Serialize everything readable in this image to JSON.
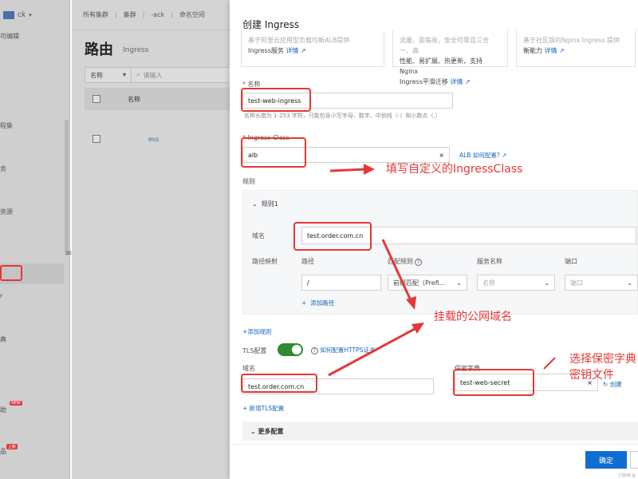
{
  "sidebar": {
    "cluster": "ck",
    "items": [
      "可编辑",
      "程集",
      "务",
      "资源",
      "r",
      "典",
      "助",
      "品"
    ],
    "badge_new": "NEW",
    "badge_hot": "上新"
  },
  "main": {
    "breadcrumb": [
      "所有集群",
      "集群",
      "-ack",
      "命名空间"
    ],
    "title": "路由",
    "subtitle": "Ingress",
    "filter_select": "名称",
    "filter_placeholder": "请输入",
    "col_name": "名称",
    "row_name": "ess"
  },
  "drawer": {
    "title": "创建 Ingress",
    "cards": [
      {
        "line1": "基于阿里云应用型负载均衡ALB提供",
        "line2": "Ingress服务",
        "link": "详情"
      },
      {
        "line1": "流量，面临易，安全可靠且三合一，高",
        "line2": "性能、易扩展、热更新，支持Nginx",
        "line3": "Ingress平滑迁移",
        "link": "详情"
      },
      {
        "line1": "基于社区版的Nginx Ingress 提供",
        "line2": "衡能力",
        "link": "详情"
      }
    ],
    "name_label": "名称",
    "name_value": "test-web-ingress",
    "name_hint": "名称长度为 1-253 字符，只能包含小写字母、数字、中划线（-）和小数点（.）",
    "class_label": "Ingress Class",
    "class_value": "alb",
    "class_link": "ALB 如何配置?",
    "rules_label": "规则",
    "rule_title": "规则1",
    "domain_label": "域名",
    "domain_value": "test.order.com.cn",
    "path_mapping_label": "路径映射",
    "path_col": "路径",
    "match_col": "匹配规则",
    "service_col": "服务名称",
    "port_col": "端口",
    "path_value": "/",
    "match_value": "前缀匹配（Prefi...",
    "service_placeholder": "名称",
    "port_placeholder": "端口",
    "add_path": "添加路径",
    "add_rule": "+添加规则",
    "tls_label": "TLS配置",
    "tls_link": "如何配置HTTPS证书",
    "tls_domain_label": "域名",
    "tls_domain_value": "test.order.com.cn",
    "tls_secret_label": "保密字典",
    "tls_secret_value": "test-web-secret",
    "create_link": "创建",
    "add_tls": "+ 新增TLS配置",
    "more_config": "更多配置",
    "ok_button": "确定",
    "watermark": "CSDN @"
  },
  "annotations": {
    "class_note": "填写自定义的IngressClass",
    "domain_note": "挂载的公网域名",
    "secret_note_line1": "选择保密字典",
    "secret_note_line2": "密钥文件"
  },
  "colors": {
    "accent": "#0f6fd0",
    "annotation_red": "#e53935",
    "toggle_on": "#2e8b2e"
  }
}
